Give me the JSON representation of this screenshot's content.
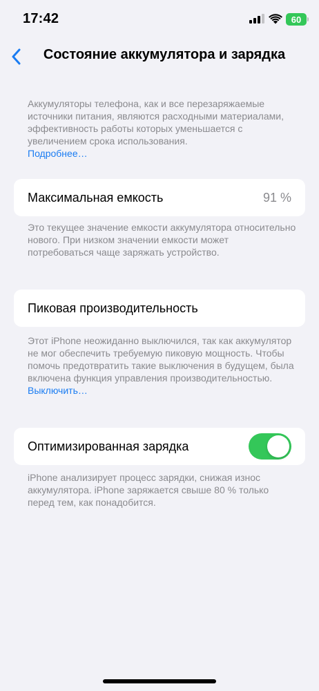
{
  "status_bar": {
    "time": "17:42",
    "battery": "60",
    "battery_color": "#34c759"
  },
  "nav": {
    "back_icon": "chevron-left-icon",
    "title": "Состояние аккумулятора и зарядка"
  },
  "intro": {
    "text": "Аккумуляторы телефона, как и все перезаряжае­мые источники питания, являются расходными материалами, эффективность работы которых уменьшается с увеличением срока использования.",
    "link": "Подробнее…"
  },
  "max_capacity": {
    "label": "Максимальная емкость",
    "value": "91 %",
    "description": "Это текущее значение емкости аккумулятора относительно нового. При низком значении емкости может потребоваться чаще заряжать устройство."
  },
  "peak_performance": {
    "label": "Пиковая производительность",
    "description": "Этот iPhone неожиданно выключился, так как аккумулятор не мог обеспечить требуемую пиковую мощность. Чтобы помочь предотвратить такие выключения в будущем, была включена функция управления производительностью.",
    "link": "Выключить…"
  },
  "optimized_charging": {
    "label": "Оптимизированная зарядка",
    "enabled": true,
    "description": "iPhone анализирует процесс зарядки, снижая износ аккумулятора. iPhone заряжается свыше 80 % только перед тем, как понадобится."
  },
  "colors": {
    "accent": "#1a7cf2",
    "toggle_on": "#34c759",
    "background": "#f2f2f7"
  }
}
